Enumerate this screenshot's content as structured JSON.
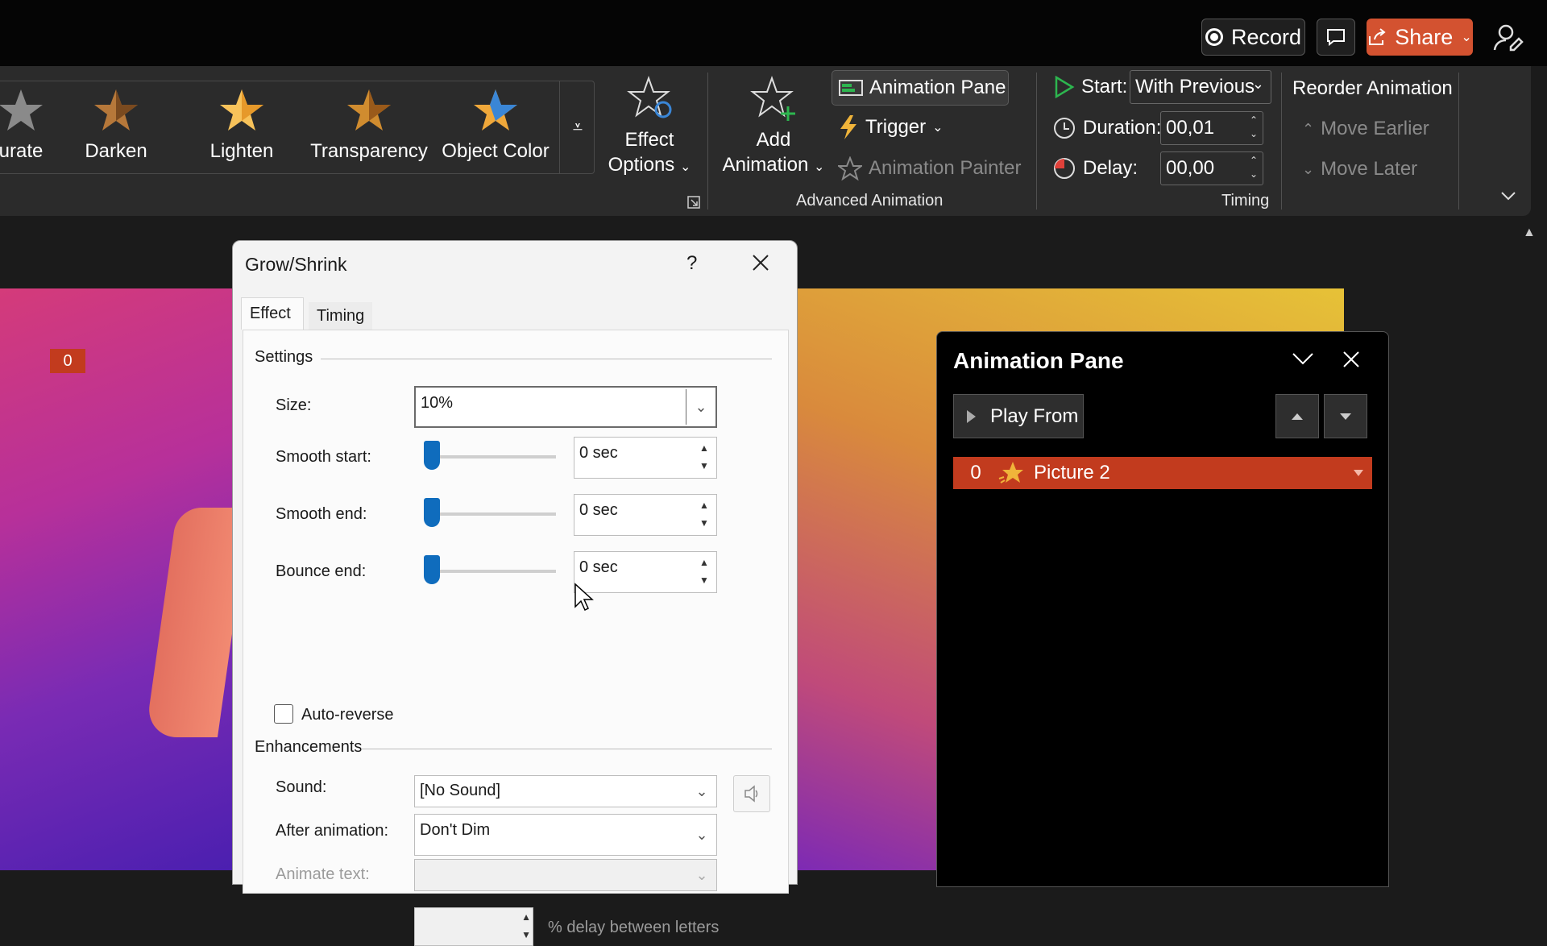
{
  "titlebar": {
    "record_label": "Record",
    "share_label": "Share"
  },
  "ribbon": {
    "gallery": [
      {
        "label": "urate",
        "star_color": "#8a8a8a"
      },
      {
        "label": "Darken",
        "star_color": "#b6783a"
      },
      {
        "label": "Lighten",
        "star_color": "#f3b545"
      },
      {
        "label": "Transparency",
        "star_color": "#d08c2f"
      },
      {
        "label": "Object Color",
        "star_color": "#3a86d6"
      }
    ],
    "effect_options_line1": "Effect",
    "effect_options_line2": "Options",
    "add_animation_line1": "Add",
    "add_animation_line2": "Animation",
    "animation_pane_label": "Animation Pane",
    "trigger_label": "Trigger",
    "animation_painter_label": "Animation Painter",
    "group_advanced": "Advanced Animation",
    "start_label": "Start:",
    "start_value": "With Previous",
    "duration_label": "Duration:",
    "duration_value": "00,01",
    "delay_label": "Delay:",
    "delay_value": "00,00",
    "group_timing": "Timing",
    "reorder_label": "Reorder Animation",
    "move_earlier": "Move Earlier",
    "move_later": "Move Later"
  },
  "slide": {
    "tag_number": "0"
  },
  "dialog": {
    "title": "Grow/Shrink",
    "help": "?",
    "tabs": [
      "Effect",
      "Timing"
    ],
    "settings_heading": "Settings",
    "size_label": "Size:",
    "size_value": "10%",
    "smooth_start_label": "Smooth start:",
    "smooth_start_value": "0 sec",
    "smooth_end_label": "Smooth end:",
    "smooth_end_value": "0 sec",
    "bounce_end_label": "Bounce end:",
    "bounce_end_value": "0 sec",
    "auto_reverse_label": "Auto-reverse",
    "enhancements_heading": "Enhancements",
    "sound_label": "Sound:",
    "sound_value": "[No Sound]",
    "after_label": "After animation:",
    "after_value": "Don't Dim",
    "animate_text_label": "Animate text:",
    "delay_letters_label": "% delay between letters"
  },
  "animation_pane": {
    "title": "Animation Pane",
    "play_from": "Play From",
    "items": [
      {
        "index": "0",
        "name": "Picture 2"
      }
    ]
  }
}
